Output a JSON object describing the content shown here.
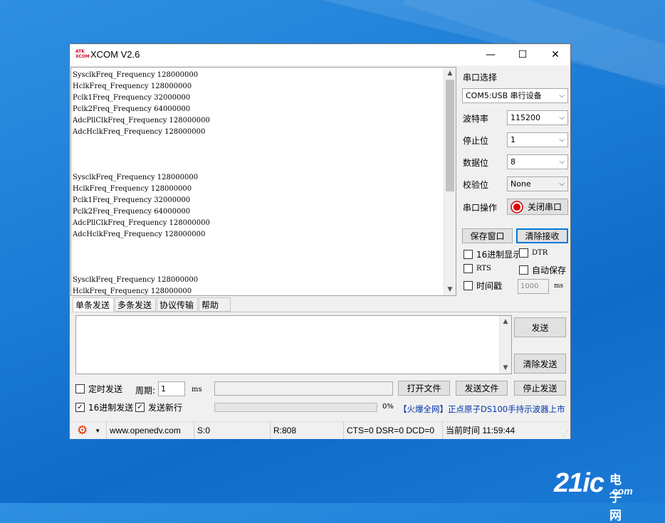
{
  "window": {
    "title": "XCOM V2.6",
    "logo_text": "ATK XCOM",
    "min_label": "—",
    "max_label": "☐",
    "close_label": "✕"
  },
  "receive": {
    "text": "SysclkFreq_Frequency 128000000\nHclkFreq_Frequency 128000000\nPclk1Freq_Frequency 32000000\nPclk2Freq_Frequency 64000000\nAdcPllClkFreq_Frequency 128000000\nAdcHclkFreq_Frequency 128000000\n\n\n\nSysclkFreq_Frequency 128000000\nHclkFreq_Frequency 128000000\nPclk1Freq_Frequency 32000000\nPclk2Freq_Frequency 64000000\nAdcPllClkFreq_Frequency 128000000\nAdcHclkFreq_Frequency 128000000\n\n\n\nSysclkFreq_Frequency 128000000\nHclkFreq_Frequency 128000000"
  },
  "settings": {
    "port_label": "串口选择",
    "port_value": "COM5:USB 串行设备",
    "baud_label": "波特率",
    "baud_value": "115200",
    "stop_label": "停止位",
    "stop_value": "1",
    "data_label": "数据位",
    "data_value": "8",
    "parity_label": "校验位",
    "parity_value": "None",
    "op_label": "串口操作",
    "op_button": "关闭串口",
    "save_window": "保存窗口",
    "clear_receive": "清除接收",
    "hex_display": "16进制显示",
    "dtr": "DTR",
    "rts": "RTS",
    "auto_save": "自动保存",
    "timestamp": "时间戳",
    "timestamp_value": "1000",
    "timestamp_unit": "ms"
  },
  "tabs": [
    "单条发送",
    "多条发送",
    "协议传输",
    "帮助"
  ],
  "send": {
    "send_button": "发送",
    "clear_send": "清除发送",
    "timed_send": "定时发送",
    "period_label": "周期:",
    "period_value": "1",
    "period_unit": "ms",
    "open_file": "打开文件",
    "send_file": "发送文件",
    "stop_send": "停止发送",
    "hex_send": "16进制发送",
    "send_newline": "发送新行",
    "progress_percent": "0%",
    "ad_text": "【火爆全网】正点原子DS100手持示波器上市"
  },
  "status": {
    "url": "www.openedv.com",
    "sent": "S:0",
    "received": "R:808",
    "lines": "CTS=0 DSR=0 DCD=0",
    "time": "当前时间 11:59:44"
  },
  "watermark": {
    "big": "21ic",
    "cn": "电子网",
    "com": ".com"
  }
}
